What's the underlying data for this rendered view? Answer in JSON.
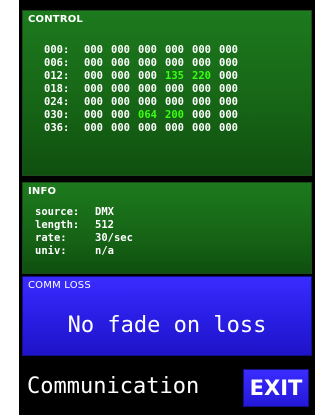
{
  "control": {
    "title": "CONTROL",
    "rows": [
      {
        "addr": "000:",
        "values": [
          "000",
          "000",
          "000",
          "000",
          "000",
          "000"
        ]
      },
      {
        "addr": "006:",
        "values": [
          "000",
          "000",
          "000",
          "000",
          "000",
          "000"
        ]
      },
      {
        "addr": "012:",
        "values": [
          "000",
          "000",
          "000",
          "135",
          "220",
          "000"
        ]
      },
      {
        "addr": "018:",
        "values": [
          "000",
          "000",
          "000",
          "000",
          "000",
          "000"
        ]
      },
      {
        "addr": "024:",
        "values": [
          "000",
          "000",
          "000",
          "000",
          "000",
          "000"
        ]
      },
      {
        "addr": "030:",
        "values": [
          "000",
          "000",
          "064",
          "200",
          "000",
          "000"
        ]
      },
      {
        "addr": "036:",
        "values": [
          "000",
          "000",
          "000",
          "000",
          "000",
          "000"
        ]
      }
    ],
    "active_color": "#39ff14",
    "normal_color": "#ffffff"
  },
  "info": {
    "title": "INFO",
    "rows": [
      {
        "key": "source:",
        "value": "DMX"
      },
      {
        "key": "length:",
        "value": "512"
      },
      {
        "key": "rate:",
        "value": "30/sec"
      },
      {
        "key": "univ:",
        "value": "n/a"
      }
    ]
  },
  "comm_loss": {
    "title": "COMM LOSS",
    "message": "No fade on loss"
  },
  "footer": {
    "label": "Communication",
    "exit_label": "EXIT"
  },
  "colors": {
    "panel_green": "#166416",
    "panel_blue": "#2a1ee6",
    "background": "#000000"
  }
}
